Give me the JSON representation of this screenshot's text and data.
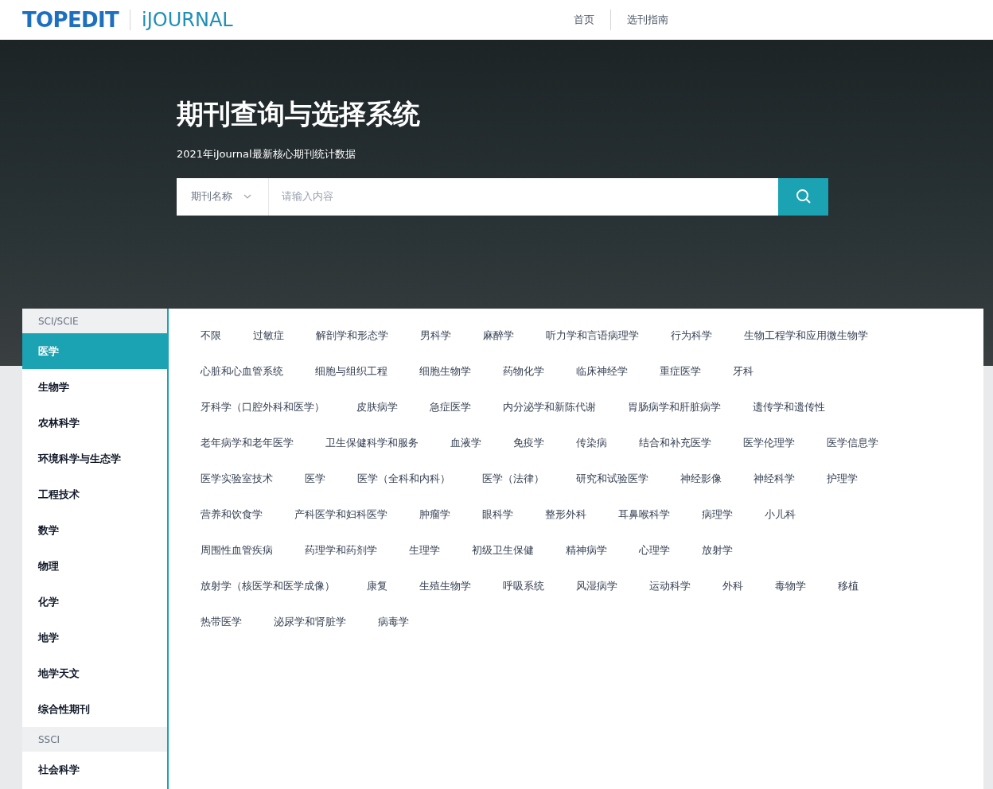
{
  "header": {
    "logo": "TOPEDIT",
    "sub_logo": "iJOURNAL",
    "nav": [
      {
        "label": "首页"
      },
      {
        "label": "选刊指南"
      }
    ]
  },
  "hero": {
    "title": "期刊查询与选择系统",
    "subtitle": "2021年iJournal最新核心期刊统计数据",
    "search": {
      "filter": "期刊名称",
      "placeholder": "请输入内容"
    }
  },
  "sidebar": {
    "groups": [
      {
        "heading": "SCI/SCIE",
        "items": [
          {
            "label": "医学",
            "selected": true
          },
          {
            "label": "生物学",
            "selected": false
          },
          {
            "label": "农林科学",
            "selected": false
          },
          {
            "label": "环境科学与生态学",
            "selected": false
          },
          {
            "label": "工程技术",
            "selected": false
          },
          {
            "label": "数学",
            "selected": false
          },
          {
            "label": "物理",
            "selected": false
          },
          {
            "label": "化学",
            "selected": false
          },
          {
            "label": "地学",
            "selected": false
          },
          {
            "label": "地学天文",
            "selected": false
          },
          {
            "label": "综合性期刊",
            "selected": false
          }
        ]
      },
      {
        "heading": "SSCI",
        "items": [
          {
            "label": "社会科学",
            "selected": false
          }
        ]
      }
    ]
  },
  "subject_lines": [
    {
      "links": [
        "不限",
        "过敏症",
        "解剖学和形态学",
        "男科学",
        "麻醉学",
        "听力学和言语病理学",
        "行为科学",
        "生物工程学和应用微生物学"
      ]
    },
    {
      "links": [
        "心脏和心血管系统",
        "细胞与组织工程",
        "细胞生物学",
        "药物化学",
        "临床神经学",
        "重症医学",
        "牙科"
      ]
    },
    {
      "links": [
        "牙科学（口腔外科和医学）",
        "皮肤病学",
        "急症医学",
        "内分泌学和新陈代谢",
        "胃肠病学和肝脏病学",
        "遗传学和遗传性"
      ]
    },
    {
      "links": [
        "老年病学和老年医学",
        "卫生保健科学和服务",
        "血液学",
        "免疫学",
        "传染病",
        "结合和补充医学",
        "医学伦理学",
        "医学信息学"
      ]
    },
    {
      "links": [
        "医学实验室技术",
        "医学",
        "医学（全科和内科）",
        "医学（法律）",
        "研究和试验医学",
        "神经影像",
        "神经科学",
        "护理学"
      ]
    },
    {
      "links": [
        "营养和饮食学",
        "产科医学和妇科医学",
        "肿瘤学",
        "眼科学",
        "整形外科",
        "耳鼻喉科学",
        "病理学",
        "小儿科"
      ]
    },
    {
      "links": [
        "周围性血管疾病",
        "药理学和药剂学",
        "生理学",
        "初级卫生保健",
        "精神病学",
        "心理学",
        "放射学"
      ]
    },
    {
      "links": [
        "放射学（核医学和医学成像）",
        "康复",
        "生殖生物学",
        "呼吸系统",
        "风湿病学",
        "运动科学",
        "外科",
        "毒物学",
        "移植"
      ]
    },
    {
      "links": [
        "热带医学",
        "泌尿学和肾脏学",
        "病毒学"
      ]
    }
  ]
}
